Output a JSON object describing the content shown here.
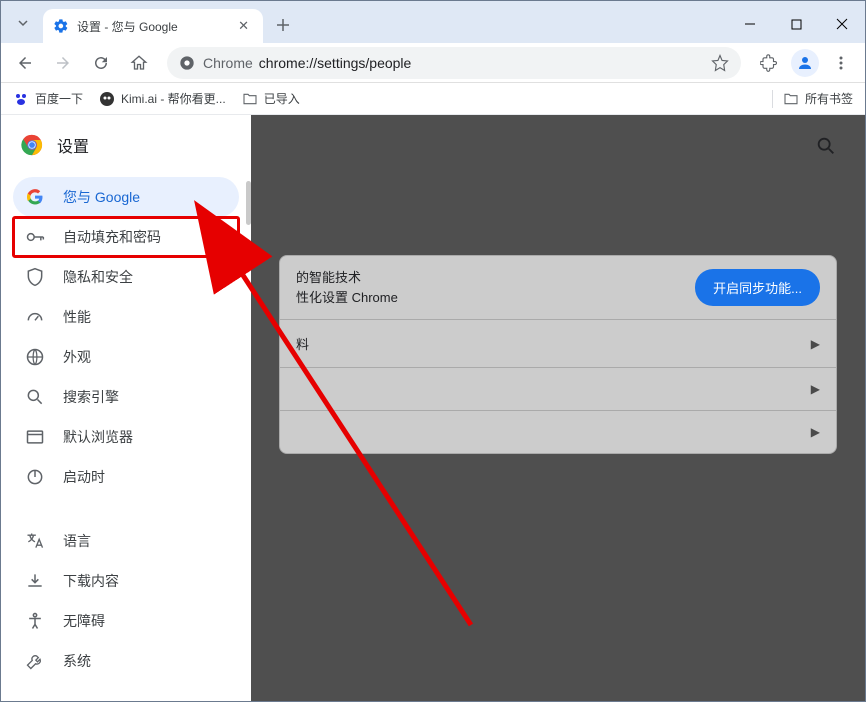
{
  "window": {
    "tab_title": "设置 - 您与 Google"
  },
  "toolbar": {
    "url": "chrome://settings/people",
    "chrome_label": "Chrome"
  },
  "bookmarks": {
    "items": [
      {
        "label": "百度一下"
      },
      {
        "label": "Kimi.ai - 帮你看更..."
      },
      {
        "label": "已导入"
      }
    ],
    "all_label": "所有书签"
  },
  "sidebar": {
    "title": "设置",
    "items": [
      {
        "name": "you-google",
        "label": "您与 Google",
        "active": true
      },
      {
        "name": "autofill-passwords",
        "label": "自动填充和密码",
        "highlighted": true
      },
      {
        "name": "privacy-security",
        "label": "隐私和安全"
      },
      {
        "name": "performance",
        "label": "性能"
      },
      {
        "name": "appearance",
        "label": "外观"
      },
      {
        "name": "search-engine",
        "label": "搜索引擎"
      },
      {
        "name": "default-browser",
        "label": "默认浏览器"
      },
      {
        "name": "on-startup",
        "label": "启动时"
      }
    ],
    "items2": [
      {
        "name": "languages",
        "label": "语言"
      },
      {
        "name": "downloads",
        "label": "下载内容"
      },
      {
        "name": "accessibility",
        "label": "无障碍"
      },
      {
        "name": "system",
        "label": "系统"
      }
    ]
  },
  "main": {
    "head_line1": "的智能技术",
    "head_line2": "性化设置 Chrome",
    "sync_button": "开启同步功能...",
    "row1": "料"
  }
}
